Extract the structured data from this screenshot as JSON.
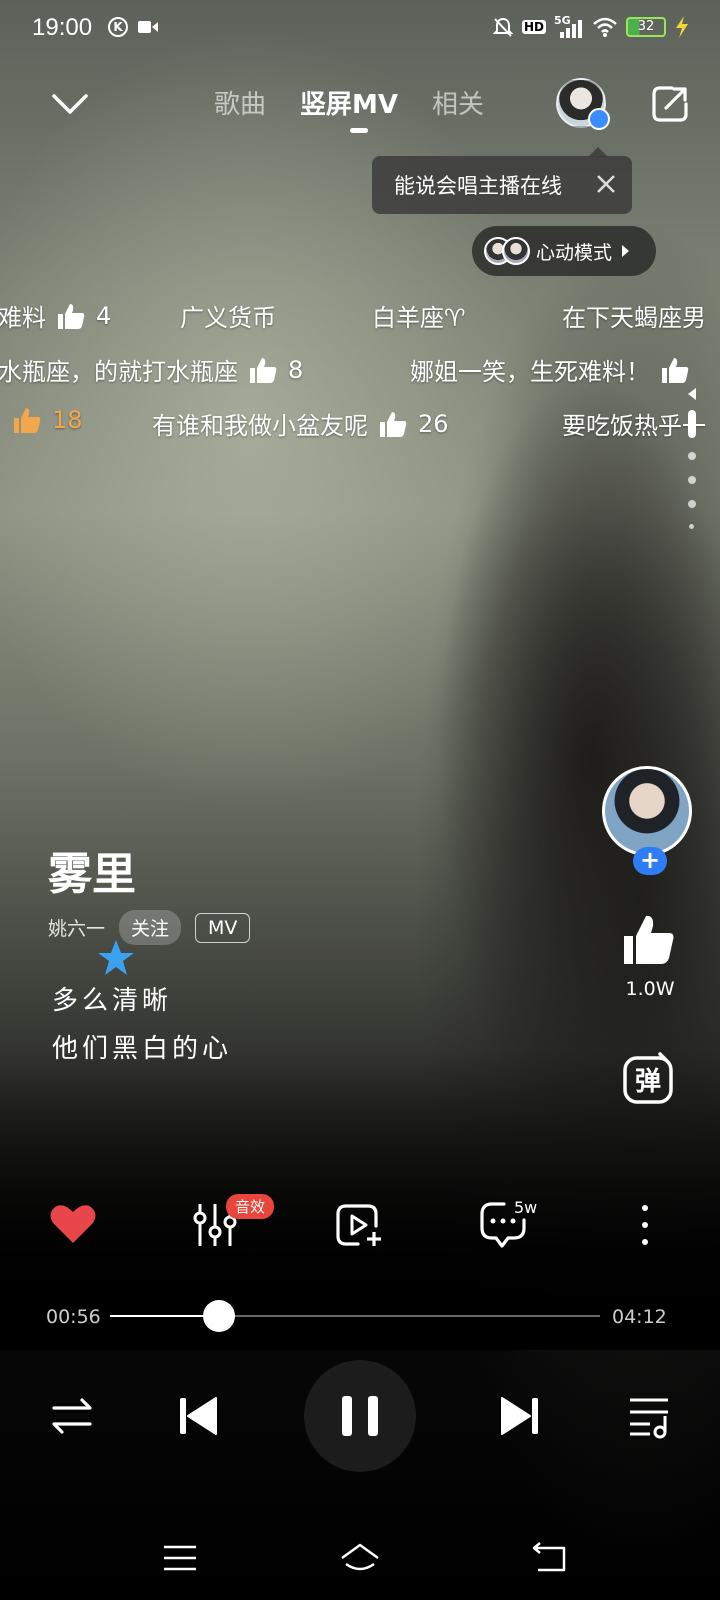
{
  "status_bar": {
    "time": "19:00",
    "battery": "32",
    "network": "5G",
    "hd": "HD"
  },
  "top_nav": {
    "tabs": [
      "歌曲",
      "竖屏MV",
      "相关"
    ],
    "active_tab": "竖屏MV"
  },
  "tooltip": {
    "text": "能说会唱主播在线"
  },
  "heart_mode": {
    "label": "心动模式"
  },
  "danmaku": [
    {
      "text": "难料",
      "likes": "4"
    },
    {
      "text": "广义货币"
    },
    {
      "text": "白羊座♈"
    },
    {
      "text": "在下天蝎座男"
    },
    {
      "text": "水瓶座，的就打水瓶座",
      "likes": "8"
    },
    {
      "text": "娜姐一笑，生死难料！"
    },
    {
      "likes": "18"
    },
    {
      "text": "有谁和我做小盆友呢",
      "likes": "26"
    },
    {
      "text": "要吃饭热乎一"
    }
  ],
  "song": {
    "title": "雾里",
    "artist": "姚六一",
    "follow_label": "关注",
    "tag": "MV",
    "lyric_line1": "多么清晰",
    "lyric_line2": "他们黑白的心"
  },
  "right_column": {
    "like_count": "1.0W",
    "danmu_label": "弹"
  },
  "actions": {
    "sound_badge": "音效",
    "comment_count": "5w"
  },
  "progress": {
    "current": "00:56",
    "total": "04:12",
    "fraction": 0.222
  },
  "colors": {
    "like_red": "#e8464a",
    "accent_blue": "#2e7cf6",
    "badge_red": "#e8463c",
    "danmaku_orange": "#f4a64a"
  }
}
